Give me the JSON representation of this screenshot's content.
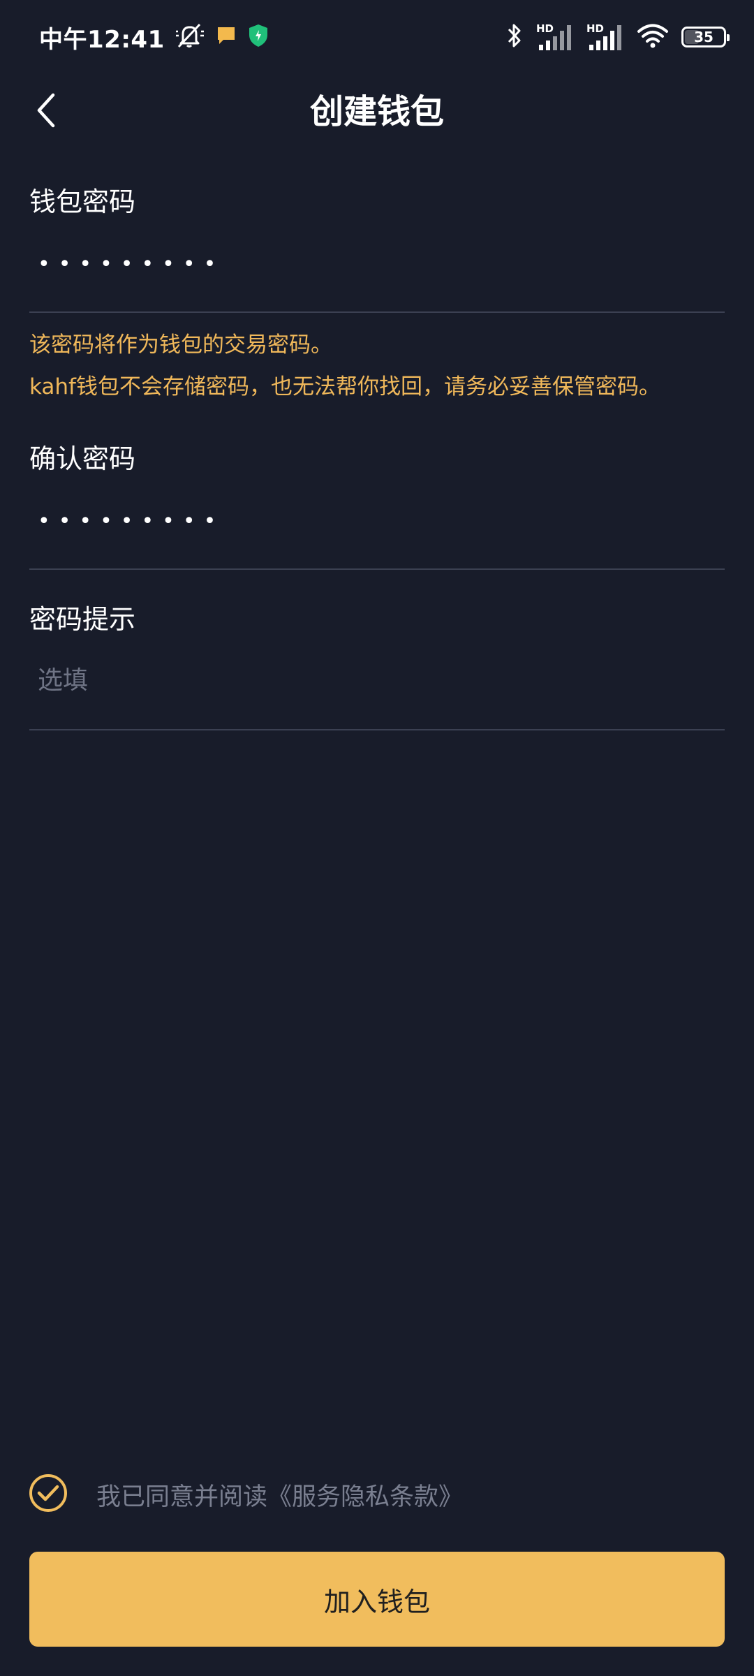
{
  "status_bar": {
    "time": "中午12:41",
    "network_label_1": "HD",
    "network_label_2": "HD",
    "battery_level": "35",
    "battery_fraction": 0.35,
    "icons": [
      "mute-icon",
      "message-icon",
      "shield-icon",
      "bluetooth-icon",
      "signal-icon",
      "signal-icon",
      "wifi-icon",
      "battery-icon"
    ],
    "shield_color": "#20c07a",
    "message_color": "#f3b94d"
  },
  "header": {
    "title": "创建钱包",
    "back_icon": "chevron-left-icon"
  },
  "form": {
    "password": {
      "label": "钱包密码",
      "value": "•••••••••"
    },
    "warning": {
      "line1": "该密码将作为钱包的交易密码。",
      "line2": "kahf钱包不会存储密码，也无法帮你找回，请务必妥善保管密码。"
    },
    "confirm_password": {
      "label": "确认密码",
      "value": "•••••••••"
    },
    "hint": {
      "label": "密码提示",
      "placeholder": "选填",
      "value": ""
    }
  },
  "agreement": {
    "text": "我已同意并阅读《服务隐私条款》",
    "checked": true
  },
  "submit": {
    "label": "加入钱包"
  },
  "colors": {
    "background": "#181c2a",
    "accent": "#f1bd5d",
    "warning_text": "#f0b85a",
    "divider": "#3b4052",
    "muted_text": "#7a7f90"
  }
}
